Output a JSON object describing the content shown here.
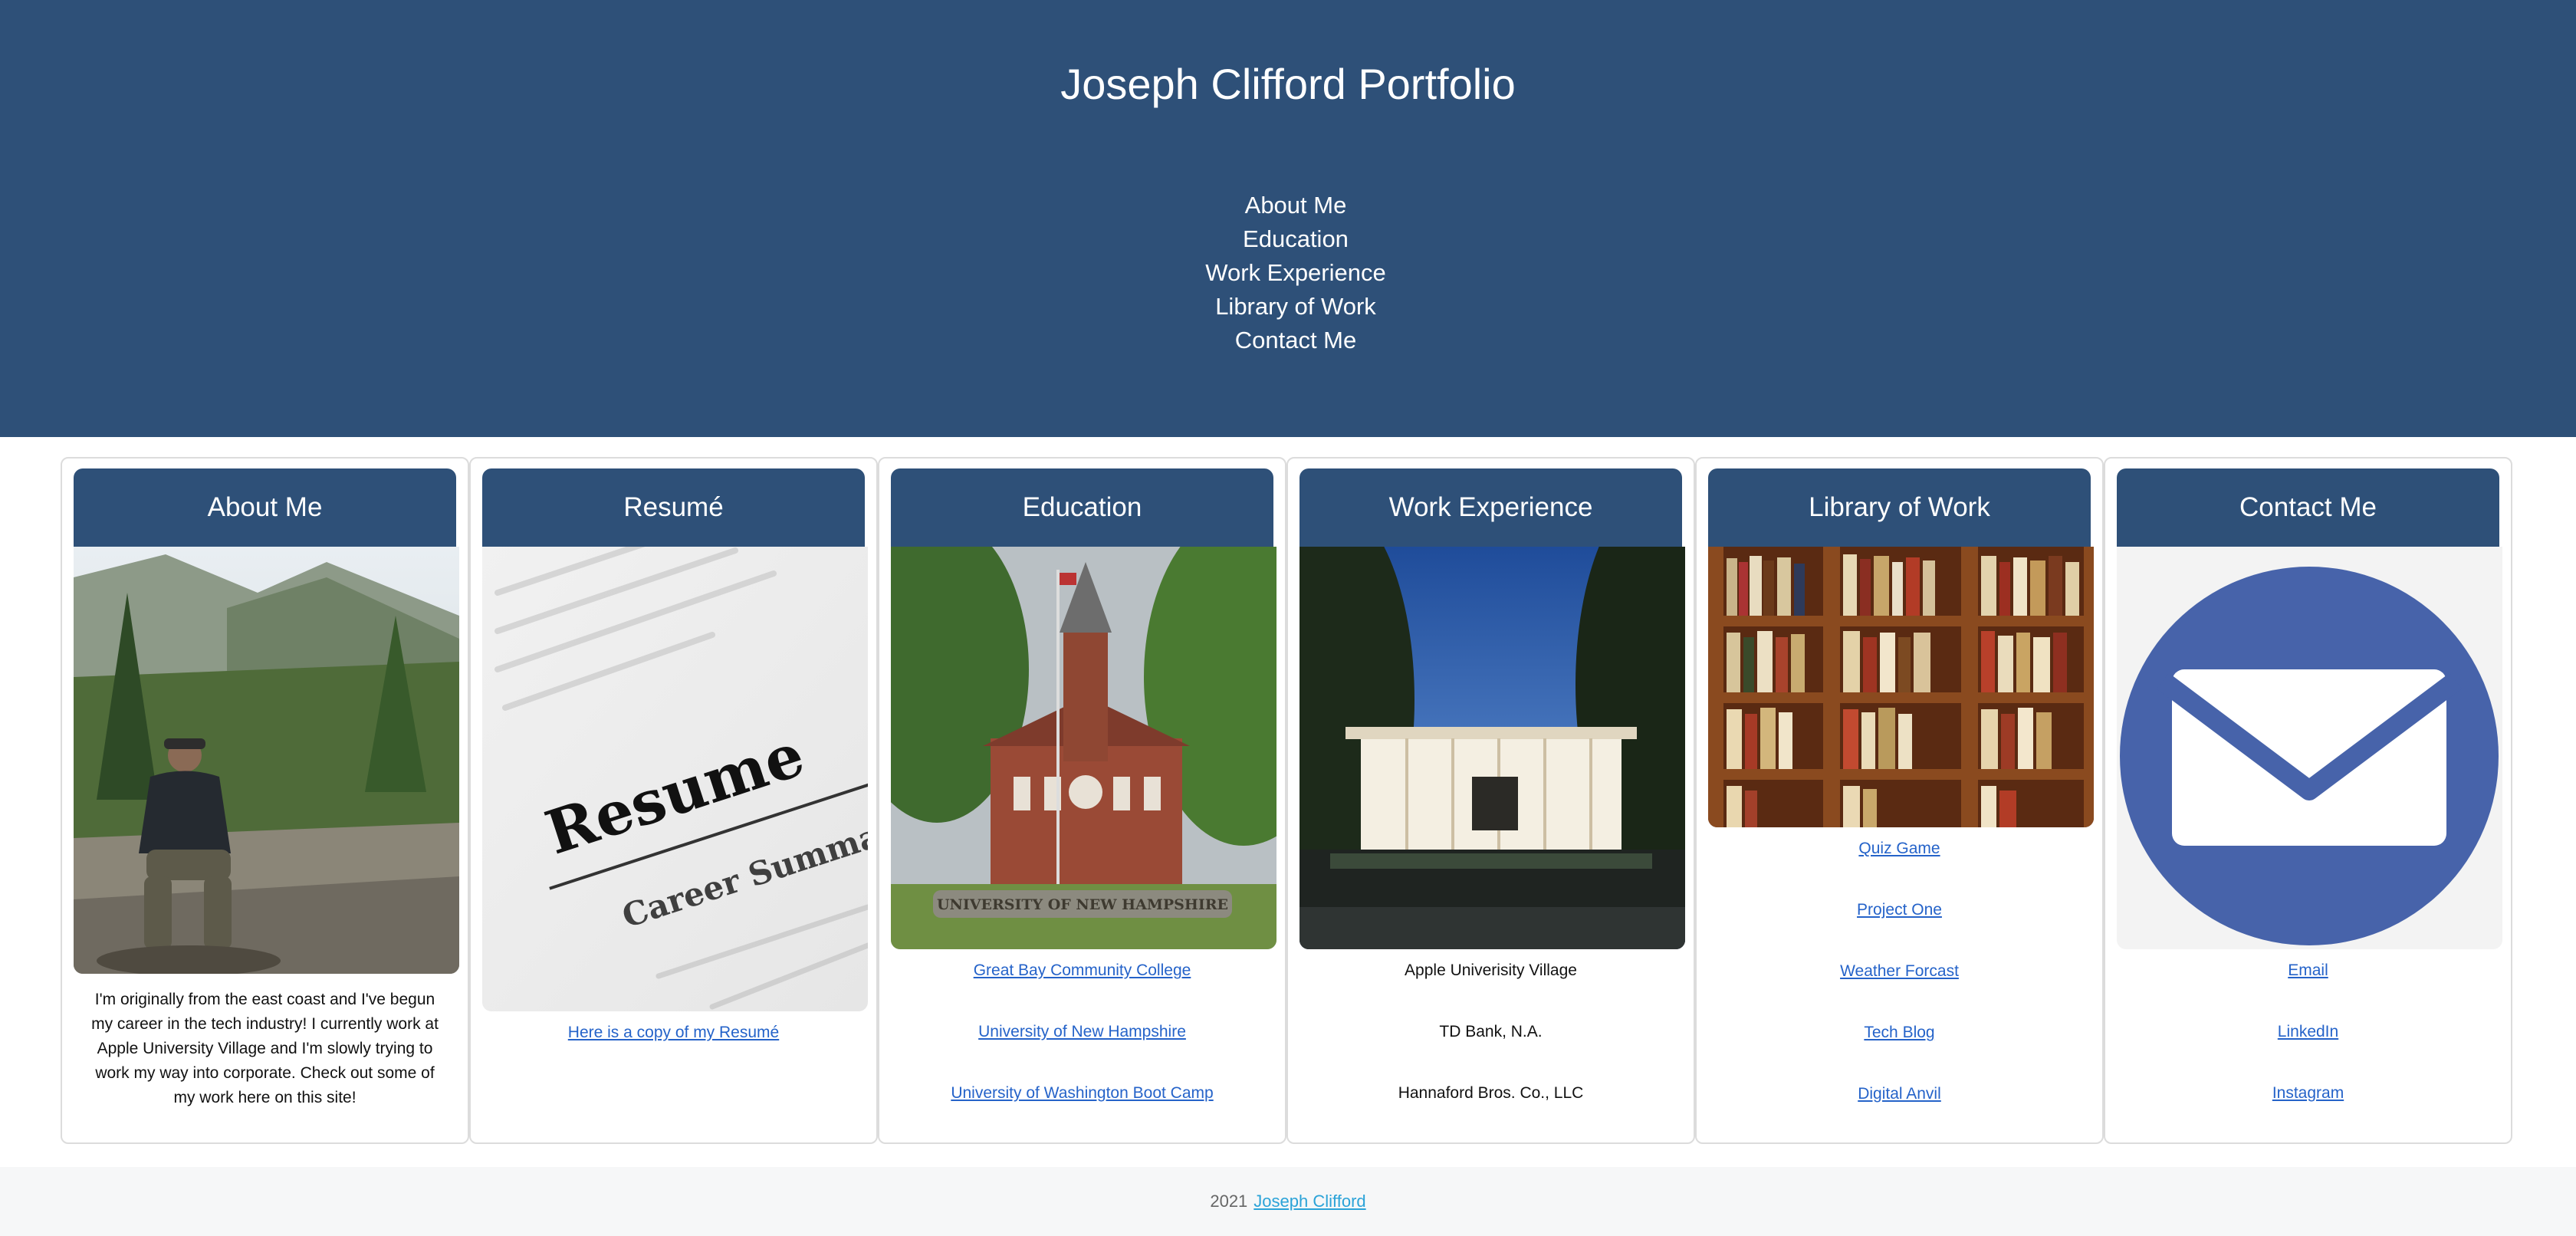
{
  "header": {
    "title": "Joseph Clifford Portfolio",
    "nav": [
      "About Me",
      "Education",
      "Work Experience",
      "Library of Work",
      "Contact Me"
    ]
  },
  "cards": {
    "about": {
      "title": "About Me",
      "text": "I'm originally from the east coast and I've begun my career in the tech industry! I currently work at Apple University Village and I'm slowly trying to work my way into corporate. Check out some of my work here on this site!"
    },
    "resume": {
      "title": "Resumé",
      "image_text_1": "Resume",
      "image_text_2": "Career Summary:",
      "link": "Here is a copy of my Resumé"
    },
    "education": {
      "title": "Education",
      "image_text": "UNIVERSITY OF NEW HAMPSHIRE",
      "links": [
        "Great Bay Community College",
        "University of New Hampshire",
        "University of Washington Boot Camp"
      ]
    },
    "work": {
      "title": "Work Experience",
      "items": [
        "Apple Univerisity Village",
        "TD Bank, N.A.",
        "Hannaford Bros. Co., LLC"
      ]
    },
    "library": {
      "title": "Library of Work",
      "links": [
        "Quiz Game",
        "Project One",
        "Weather Forcast",
        "Tech Blog",
        "Digital Anvil"
      ]
    },
    "contact": {
      "title": "Contact Me",
      "links": [
        "Email",
        "LinkedIn",
        "Instagram"
      ]
    }
  },
  "footer": {
    "year": "2021",
    "name": "Joseph Clifford"
  },
  "colors": {
    "header_bg": "#2e5078",
    "link": "#2563c9",
    "footer_link": "#2ba3d8",
    "mail_icon": "#4763aa"
  }
}
